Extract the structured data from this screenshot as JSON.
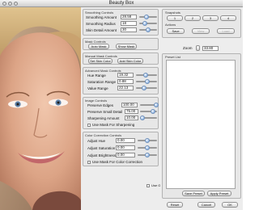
{
  "window": {
    "title": "Beauty Box"
  },
  "smoothing_controls": {
    "label": "Smoothing Controls",
    "rows": [
      {
        "label": "Smoothing Amount",
        "value": "28.58",
        "level": 0.4
      },
      {
        "label": "Smoothing Radius",
        "value": "18",
        "level": 0.32
      },
      {
        "label": "Skin Detail Amount",
        "value": "30",
        "level": 0.5
      }
    ]
  },
  "mask_controls": {
    "label": "Mask Controls",
    "auto_mask": "Auto Mask",
    "show_mask": "Show Mask"
  },
  "manual_mask_controls": {
    "label": "Manual Mask Controls",
    "set_skin_color": "Set Skin Color",
    "add_skin_color": "Add Skin Color"
  },
  "advanced_mask_controls": {
    "label": "Advanced Mask Controls",
    "rows": [
      {
        "label": "Hue Range",
        "value": "19.32",
        "level": 0.45
      },
      {
        "label": "Saturation Range",
        "value": "0.88",
        "level": 0.55
      },
      {
        "label": "Value Range",
        "value": "22.13",
        "level": 0.4
      }
    ]
  },
  "image_controls": {
    "label": "Image Controls",
    "rows": [
      {
        "label": "Preserve Edges",
        "value": "100.00",
        "level": 0.95
      },
      {
        "label": "Preserve Small Detail",
        "value": "75.00",
        "level": 0.75
      },
      {
        "label": "Sharpening Amount",
        "value": "10.00",
        "level": 0.15
      }
    ],
    "use_mask_sharpening": "Use Mask For Sharpening"
  },
  "color_correction": {
    "label": "Color Correction Controls",
    "rows": [
      {
        "label": "Adjust Hue",
        "value": "0.00",
        "level": 0.5
      },
      {
        "label": "Adjust Saturation",
        "value": "0.00",
        "level": 0.5
      },
      {
        "label": "Adjust Brightness",
        "value": "0.00",
        "level": 0.5
      }
    ],
    "use_mask_color": "Use Mask For Color Correction"
  },
  "use_gpu": "Use GPU",
  "snapshots": {
    "label": "Snapshots",
    "buttons": [
      "1",
      "2",
      "3",
      "4"
    ],
    "actions_label": "Actions",
    "save": "Save",
    "view": "View",
    "load": "Load"
  },
  "zoom": {
    "label": "Zoom",
    "value": "33.80"
  },
  "preset_list": {
    "label": "Preset List",
    "save_preset": "Save Preset",
    "apply_preset": "Apply Preset"
  },
  "footer": {
    "reset": "Reset",
    "cancel": "Cancel",
    "ok": "OK"
  },
  "colors": {
    "accent": "#5d8fcf",
    "window": "#ececec",
    "skin": "#d9a688"
  }
}
